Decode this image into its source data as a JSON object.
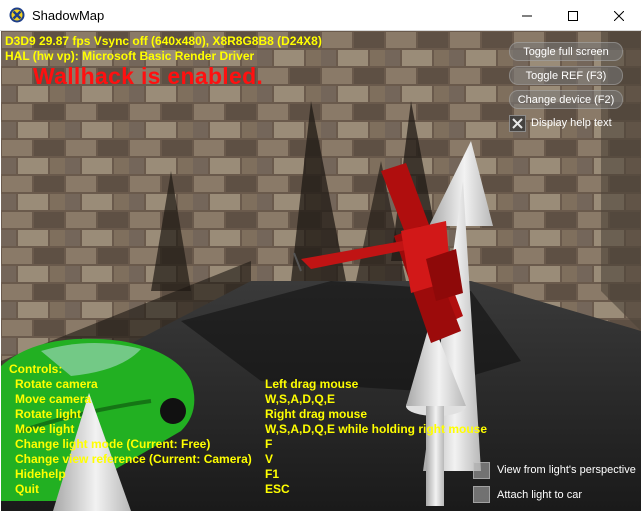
{
  "window": {
    "title": "ShadowMap",
    "minimize_icon": "minimize-icon",
    "maximize_icon": "maximize-icon",
    "close_icon": "close-icon"
  },
  "stats": {
    "line1": "D3D9 29.87 fps Vsync off (640x480), X8R8G8B8 (D24X8)",
    "line2": "HAL (hw vp): Microsoft Basic Render Driver"
  },
  "wallhack_text": "Wallhack is enabled.",
  "hud_buttons": {
    "toggle_full_screen": "Toggle full screen",
    "toggle_ref": "Toggle REF (F3)",
    "change_device": "Change device (F2)"
  },
  "checkboxes": {
    "display_help": {
      "label": "Display help text",
      "checked": true
    },
    "view_from_light": {
      "label": "View from light's perspective",
      "checked": false
    },
    "attach_light": {
      "label": "Attach light to car",
      "checked": false
    }
  },
  "controls": {
    "title": "Controls:",
    "rows": [
      {
        "action": "Rotate camera",
        "key": "Left drag mouse"
      },
      {
        "action": "Move camera",
        "key": "W,S,A,D,Q,E"
      },
      {
        "action": "Rotate light",
        "key": "Right drag mouse"
      },
      {
        "action": "Move light",
        "key": "W,S,A,D,Q,E while holding right mouse"
      },
      {
        "action": "Change light mode (Current: Free)",
        "key": "F"
      },
      {
        "action": "Change view reference (Current: Camera)",
        "key": "V"
      },
      {
        "action": "Hidehelp",
        "key": "F1"
      },
      {
        "action": "Quit",
        "key": "ESC"
      }
    ]
  },
  "colors": {
    "hud_text": "#ffff00",
    "wallhack": "#ff1010",
    "airplane": "#c01010",
    "car": "#22b022"
  }
}
